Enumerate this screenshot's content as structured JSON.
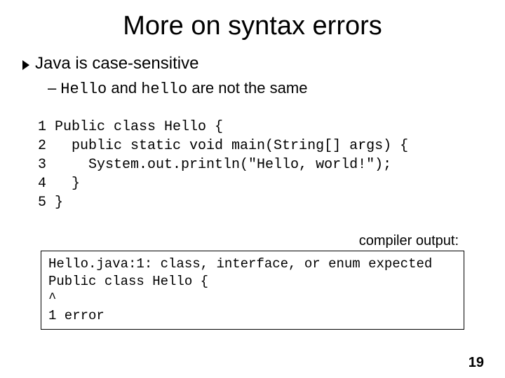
{
  "title": "More on syntax errors",
  "bullet": "Java is case-sensitive",
  "sub": {
    "dash": "–",
    "code1": "Hello",
    "mid": " and ",
    "code2": "hello",
    "tail": " are not the same"
  },
  "code": "1 Public class Hello {\n2   public static void main(String[] args) {\n3     System.out.println(\"Hello, world!\");\n4   }\n5 }",
  "compiler_label": "compiler output:",
  "compiler_output": "Hello.java:1: class, interface, or enum expected\nPublic class Hello {\n^\n1 error",
  "page_number": "19"
}
